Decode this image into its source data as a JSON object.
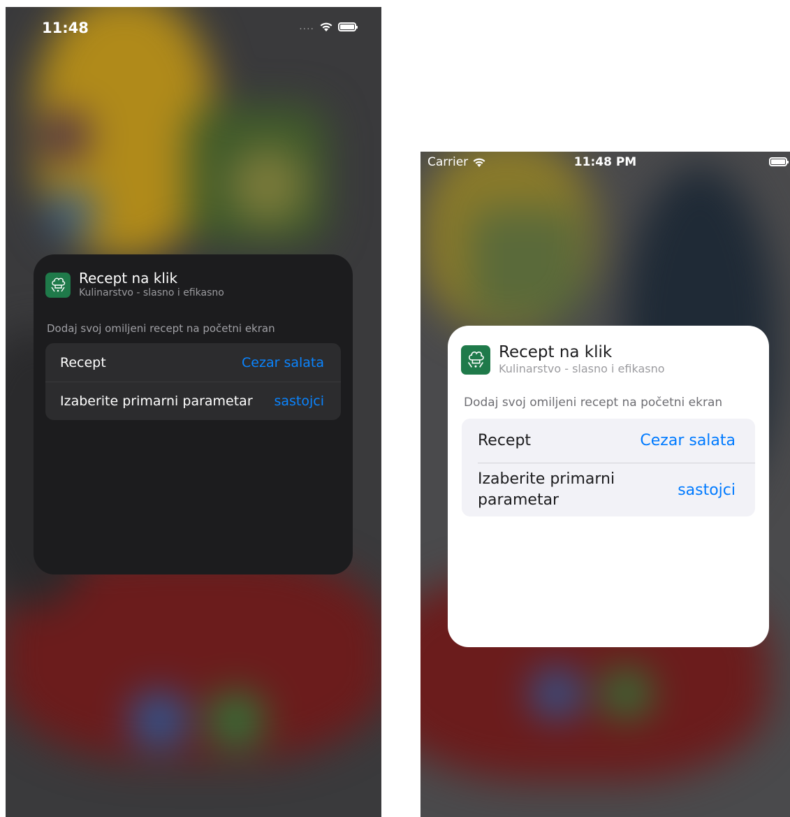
{
  "dark_screen": {
    "status_bar": {
      "time": "11:48",
      "signal": "....",
      "icons": [
        "signal-dots-icon",
        "wifi-icon",
        "battery-icon"
      ]
    },
    "widget": {
      "app_name": "Recept na klik",
      "app_subtitle": "Kulinarstvo - slasno i efikasno",
      "app_icon": "chef-hat-icon",
      "description": "Dodaj svoj omiljeni recept na početni ekran",
      "parameters": [
        {
          "label": "Recept",
          "value": "Cezar salata"
        },
        {
          "label": "Izaberite primarni parametar",
          "value": "sastojci"
        }
      ]
    }
  },
  "light_screen": {
    "status_bar": {
      "carrier": "Carrier",
      "time": "11:48 PM",
      "icons": [
        "wifi-icon",
        "battery-icon"
      ]
    },
    "widget": {
      "app_name": "Recept na klik",
      "app_subtitle": "Kulinarstvo - slasno i efikasno",
      "app_icon": "chef-hat-icon",
      "description": "Dodaj svoj omiljeni recept na početni ekran",
      "parameters": [
        {
          "label": "Recept",
          "value": "Cezar salata"
        },
        {
          "label": "Izaberite primarni parametar",
          "value": "sastojci"
        }
      ]
    }
  },
  "colors": {
    "accent": "#0a84ff",
    "dark_card": "#1c1c1e",
    "light_card": "#ffffff",
    "app_icon_bg": "#1f7a4a"
  }
}
